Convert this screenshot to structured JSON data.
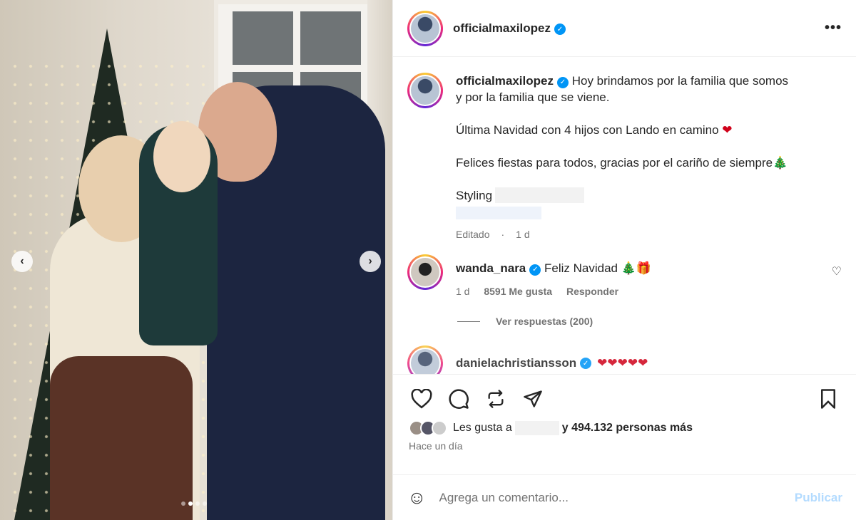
{
  "post": {
    "username": "officialmaxilopez",
    "verified_mark": "✓",
    "more_label": "•••",
    "caption_lines": [
      "Hoy brindamos por la familia que somos",
      "y por la familia que se viene."
    ],
    "caption_line2": "Última Navidad con 4 hijos con Lando en camino",
    "caption_line2_emoji": "❤",
    "caption_line3": "Felices fiestas para todos, gracias por el cariño de siempre",
    "caption_line3_emoji": "🎄",
    "styling_label": "Styling",
    "edited_label": "Editado",
    "edited_time": "1 d",
    "carousel": {
      "slide_count": 4,
      "active_index": 1,
      "prev": "‹",
      "next": "›"
    }
  },
  "comments": [
    {
      "username": "wanda_nara",
      "verified_mark": "✓",
      "text": "Feliz Navidad",
      "emoji_tree": "🎄",
      "emoji_gift": "🎁",
      "time": "1 d",
      "likes": "8591 Me gusta",
      "reply_label": "Responder",
      "like_icon": "♡",
      "view_replies": "Ver respuestas (200)"
    }
  ],
  "partial_comment": {
    "username": "danielachristiansson",
    "emojis": "❤❤❤❤❤"
  },
  "actions": {
    "likes_prefix": "Les gusta a",
    "likes_suffix": "y 494.132 personas más",
    "time_ago": "Hace un día"
  },
  "composer": {
    "placeholder": "Agrega un comentario...",
    "emoji_icon": "☺",
    "publish_label": "Publicar"
  }
}
